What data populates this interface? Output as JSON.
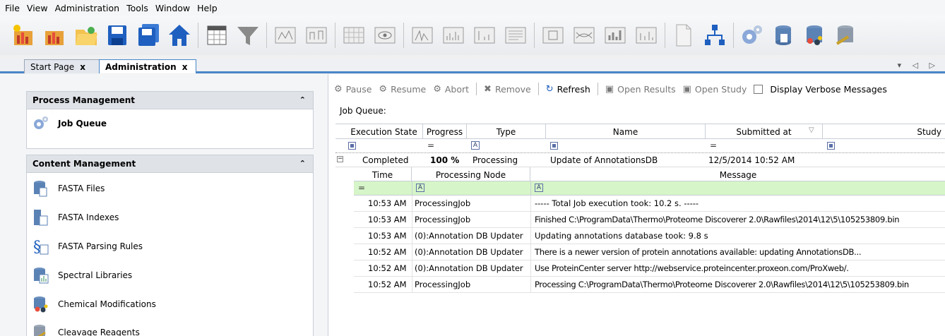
{
  "menu": [
    "File",
    "View",
    "Administration",
    "Tools",
    "Window",
    "Help"
  ],
  "tabs": [
    {
      "label": "Start Page",
      "close": "x"
    },
    {
      "label": "Administration",
      "close": "x"
    }
  ],
  "tab_nav": "▾ ◁ ▷",
  "left": {
    "process_title": "Process Management",
    "process_items": [
      "Job Queue"
    ],
    "content_title": "Content Management",
    "content_items": [
      "FASTA Files",
      "FASTA Indexes",
      "FASTA Parsing Rules",
      "Spectral Libraries",
      "Chemical Modifications",
      "Cleavage Reagents"
    ],
    "collapse_glyph": "≈"
  },
  "actions": {
    "pause": "Pause",
    "resume": "Resume",
    "abort": "Abort",
    "remove": "Remove",
    "refresh": "Refresh",
    "open_results": "Open Results",
    "open_study": "Open Study",
    "verbose": "Display Verbose Messages"
  },
  "job_queue_label": "Job Queue:",
  "grid": {
    "headers": [
      "Execution State",
      "Progress",
      "Type",
      "Name",
      "Submitted at",
      "Study"
    ],
    "row": {
      "state": "Completed",
      "progress": "100 %",
      "type": "Processing",
      "name": "Update of AnnotationsDB",
      "submitted": "12/5/2014 10:52 AM",
      "study": ""
    }
  },
  "subgrid": {
    "headers": [
      "Time",
      "Processing Node",
      "Message"
    ],
    "rows": [
      {
        "time": "10:53 AM",
        "node": "ProcessingJob",
        "message": "----- Total Job execution took: 10.2 s. -----"
      },
      {
        "time": "10:53 AM",
        "node": "ProcessingJob",
        "message": "Finished C:\\ProgramData\\Thermo\\Proteome Discoverer 2.0\\Rawfiles\\2014\\12\\5\\105253809.bin"
      },
      {
        "time": "10:53 AM",
        "node": "(0):Annotation DB Updater",
        "message": "Updating annotations database took: 9.8 s"
      },
      {
        "time": "10:52 AM",
        "node": "(0):Annotation DB Updater",
        "message": "There is a newer version of protein annotations available: updating AnnotationsDB..."
      },
      {
        "time": "10:52 AM",
        "node": "(0):Annotation DB Updater",
        "message": "Use ProteinCenter server http://webservice.proteincenter.proxeon.com/ProXweb/."
      },
      {
        "time": "10:52 AM",
        "node": "ProcessingJob",
        "message": "Processing C:\\ProgramData\\Thermo\\Proteome Discoverer 2.0\\Rawfiles\\2014\\12\\5\\105253809.bin"
      }
    ]
  }
}
